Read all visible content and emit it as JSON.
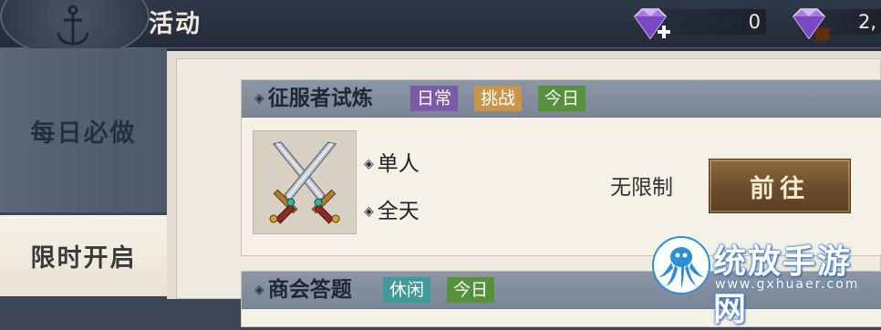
{
  "header": {
    "title": "活动",
    "currencies": [
      {
        "icon": "purple-gem-plus-icon",
        "value": "0"
      },
      {
        "icon": "purple-gem-bound-icon",
        "badge": "绑",
        "value": "2,"
      }
    ]
  },
  "sidebar": {
    "items": [
      {
        "label": "每日必做",
        "active": true
      },
      {
        "label": "限时开启",
        "active": false
      }
    ]
  },
  "activities": [
    {
      "title": "征服者试炼",
      "tags": [
        {
          "label": "日常",
          "color": "#7d5aa8"
        },
        {
          "label": "挑战",
          "color": "#c8954b"
        },
        {
          "label": "今日",
          "color": "#58913c"
        }
      ],
      "icon": "crossed-swords-icon",
      "details": [
        "单人",
        "全天"
      ],
      "limit": "无限制",
      "action": "前往"
    },
    {
      "title": "商会答题",
      "tags": [
        {
          "label": "休闲",
          "color": "#3f9a98"
        },
        {
          "label": "今日",
          "color": "#58913c"
        }
      ]
    }
  ],
  "watermark": {
    "title": "统放手游网",
    "url": "www.gxhuaer.com"
  }
}
